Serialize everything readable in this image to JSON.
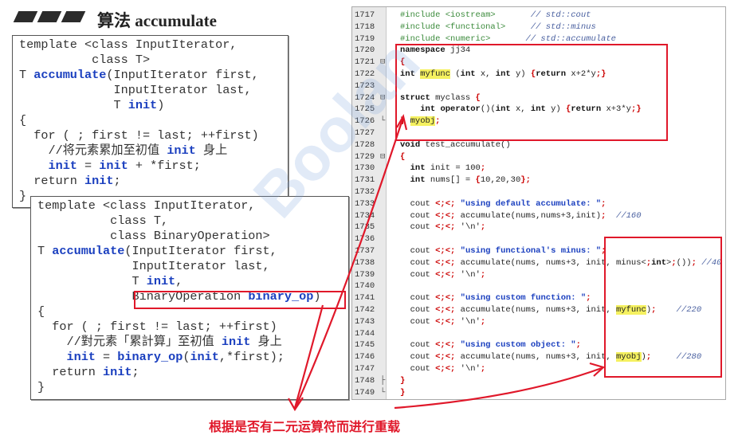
{
  "title": "算法 accumulate",
  "panel1": {
    "lines": [
      "template <class InputIterator,",
      "          class T>",
      "T accumulate(InputIterator first,",
      "             InputIterator last,",
      "             T init)",
      "{",
      "  for ( ; first != last; ++first)",
      "    //将元素累加至初值 init 身上",
      "    init = init + *first;",
      "  return init;",
      "}"
    ]
  },
  "panel2": {
    "lines": [
      "template <class InputIterator,",
      "          class T,",
      "          class BinaryOperation>",
      "T accumulate(InputIterator first,",
      "             InputIterator last,",
      "             T init,",
      "             BinaryOperation binary_op)",
      "{",
      "  for ( ; first != last; ++first)",
      "    //對元素「累計算」至初值 init 身上",
      "    init = binary_op(init,*first);",
      "  return init;",
      "}"
    ]
  },
  "editor": {
    "line_numbers": [
      "1717",
      "1718",
      "1719",
      "1720",
      "1721",
      "1722",
      "1723",
      "1724",
      "1725",
      "1726",
      "1727",
      "1728",
      "1729",
      "1730",
      "1731",
      "1732",
      "1733",
      "1734",
      "1735",
      "1736",
      "1737",
      "1738",
      "1739",
      "1740",
      "1741",
      "1742",
      "1743",
      "1744",
      "1745",
      "1746",
      "1747",
      "1748",
      "1749"
    ],
    "code": [
      "#include <iostream>       // std::cout",
      "#include <functional>     // std::minus",
      "#include <numeric>       // std::accumulate",
      "namespace jj34",
      "{",
      "int myfunc (int x, int y) {return x+2*y;}",
      "",
      "struct myclass {",
      "    int operator()(int x, int y) {return x+3*y;}",
      "} myobj;",
      "",
      "void test_accumulate()",
      "{",
      "  int init = 100;",
      "  int nums[] = {10,20,30};",
      "",
      "  cout << \"using default accumulate: \";",
      "  cout << accumulate(nums,nums+3,init);  //160",
      "  cout << '\\n';",
      "",
      "  cout << \"using functional's minus: \";",
      "  cout << accumulate(nums, nums+3, init, minus<int>()); //40",
      "  cout << '\\n';",
      "",
      "  cout << \"using custom function: \";",
      "  cout << accumulate(nums, nums+3, init, myfunc);    //220",
      "  cout << '\\n';",
      "",
      "  cout << \"using custom object: \";",
      "  cout << accumulate(nums, nums+3, init, myobj);     //280",
      "  cout << '\\n';",
      "}",
      "}"
    ]
  },
  "watermark": "Boolan",
  "caption": "根据是否有二元运算符而进行重载",
  "colors": {
    "accent_red": "#e0182a",
    "keyword_blue": "#1a3fbf",
    "highlight": "#f5f160"
  }
}
